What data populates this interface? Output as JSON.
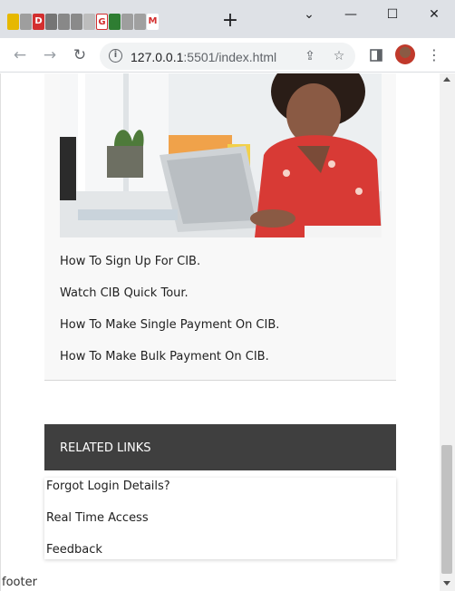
{
  "browser": {
    "new_tab": "+",
    "controls": {
      "minimize": "—",
      "maximize": "☐",
      "close": "✕",
      "tab_menu": "⌄"
    },
    "url_host": "127.0.0.1",
    "url_rest": ":5501/index.html",
    "favicon_letters": [
      "",
      "",
      "D",
      "",
      "",
      "",
      "",
      "G",
      "",
      "",
      "",
      "M"
    ]
  },
  "card": {
    "links": [
      "How To Sign Up For CIB.",
      "Watch CIB Quick Tour.",
      "How To Make Single Payment On CIB.",
      "How To Make Bulk Payment On CIB."
    ]
  },
  "related": {
    "title": "RELATED LINKS",
    "links": [
      "Forgot Login Details?",
      "Real Time Access",
      "Feedback"
    ]
  },
  "footer": {
    "label": "footer"
  },
  "colors": {
    "related_header_bg": "#3f3f3f",
    "card_bg": "#f8f8f8",
    "tabstrip_bg": "#dee1e6"
  }
}
